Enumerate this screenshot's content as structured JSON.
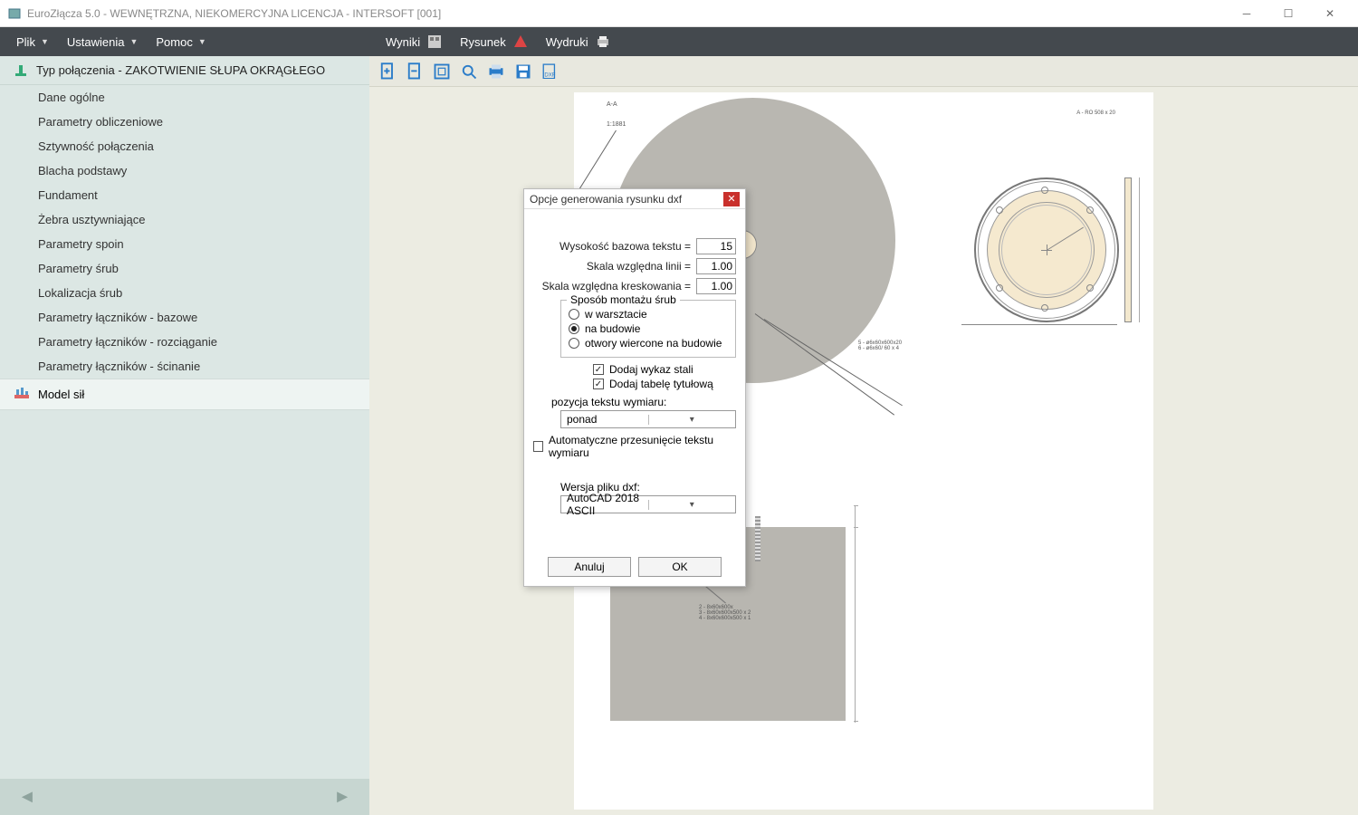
{
  "title": "EuroZłącza 5.0 - WEWNĘTRZNA, NIEKOMERCYJNA LICENCJA - INTERSOFT [001]",
  "menu": {
    "plik": "Plik",
    "ustawienia": "Ustawienia",
    "pomoc": "Pomoc"
  },
  "tree": {
    "header": "Typ połączenia - ZAKOTWIENIE SŁUPA OKRĄGŁEGO",
    "items": [
      "Dane ogólne",
      "Parametry obliczeniowe",
      "Sztywność połączenia",
      "Blacha podstawy",
      "Fundament",
      "Żebra usztywniające",
      "Parametry spoin",
      "Parametry śrub",
      "Lokalizacja śrub",
      "Parametry łączników - bazowe",
      "Parametry łączników - rozciąganie",
      "Parametry łączników - ścinanie"
    ],
    "model": "Model sił"
  },
  "toolbar": {
    "wyniki": "Wyniki",
    "rysunek": "Rysunek",
    "wydruki": "Wydruki"
  },
  "drawing": {
    "lab_tl": "A-A",
    "lab_tl2": "1:1881",
    "lab_top_right": "A - RO 508 x 20",
    "lab_mid": "5 - ø6x60x600x20\n6 - ø6x60/ 60 x 4",
    "lab_block": "2 - 8x60x600x\n3 - 8x60x600x500 x 2\n4 - 8x60x600x500 x 1"
  },
  "dialog": {
    "title": "Opcje generowania rysunku dxf",
    "h_text": "Wysokość bazowa tekstu =",
    "h_text_v": "15",
    "scale_line": "Skala względna linii =",
    "scale_line_v": "1.00",
    "scale_hatch": "Skala względna kreskowania =",
    "scale_hatch_v": "1.00",
    "mount_legend": "Sposób montażu śrub",
    "r1": "w warsztacie",
    "r2": "na budowie",
    "r3": "otwory wiercone na budowie",
    "chk_steel": "Dodaj wykaz stali",
    "chk_title": "Dodaj tabelę tytułową",
    "pos_label": "pozycja tekstu wymiaru:",
    "pos_val": "ponad",
    "auto": "Automatyczne przesunięcie tekstu wymiaru",
    "ver_label": "Wersja pliku dxf:",
    "ver_val": "AutoCAD 2018 ASCII",
    "cancel": "Anuluj",
    "ok": "OK"
  }
}
